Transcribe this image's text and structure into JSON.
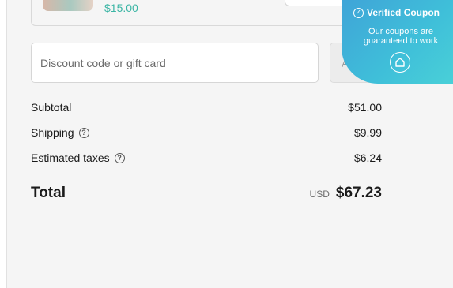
{
  "product": {
    "price": "$15.00"
  },
  "discount": {
    "placeholder": "Discount code or gift card",
    "apply_label": "Apply"
  },
  "summary": {
    "subtotal_label": "Subtotal",
    "subtotal_value": "$51.00",
    "shipping_label": "Shipping",
    "shipping_value": "$9.99",
    "taxes_label": "Estimated taxes",
    "taxes_value": "$6.24",
    "help_icon": "?",
    "total_label": "Total",
    "currency": "USD",
    "total_value": "$67.23"
  },
  "coupon_badge": {
    "title": "Verified Coupon",
    "subtitle": "Our coupons are guaranteed to work",
    "icons": [
      "check-circle-icon",
      "home-icon"
    ]
  },
  "colors": {
    "accent": "#3ab5a4",
    "badge_start": "#3fa3d8",
    "badge_end": "#4bd3d8",
    "panel_bg": "#f5f5f5"
  }
}
